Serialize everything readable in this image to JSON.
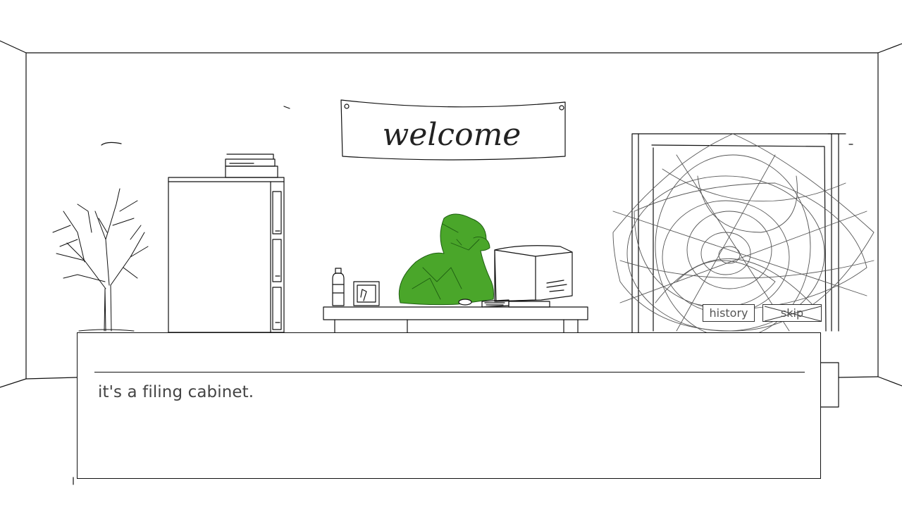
{
  "scene": {
    "banner_text": "welcome"
  },
  "dialogue": {
    "text": "it's a filing cabinet."
  },
  "quick_menu": {
    "history_label": "history",
    "skip_label": "skip"
  },
  "colors": {
    "line": "#111111",
    "character_green": "#4aa62a",
    "background": "#ffffff"
  }
}
